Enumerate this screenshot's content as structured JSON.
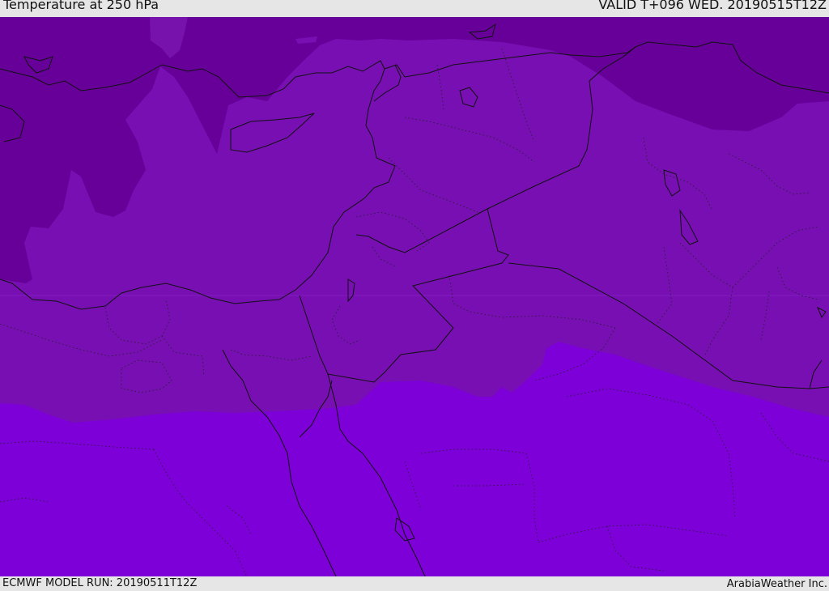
{
  "header": {
    "title": "Temperature at 250 hPa",
    "valid": "VALID T+096 WED. 20190515T12Z"
  },
  "footer": {
    "model_run": "ECMWF MODEL RUN: 20190511T12Z",
    "brand": "ArabiaWeather Inc."
  },
  "colors": {
    "band_coldest": "#670099",
    "band_cold": "#780fb3",
    "band_middle": "#7a12bb",
    "band_warm": "#7d00d9",
    "coastline": "#111111"
  }
}
